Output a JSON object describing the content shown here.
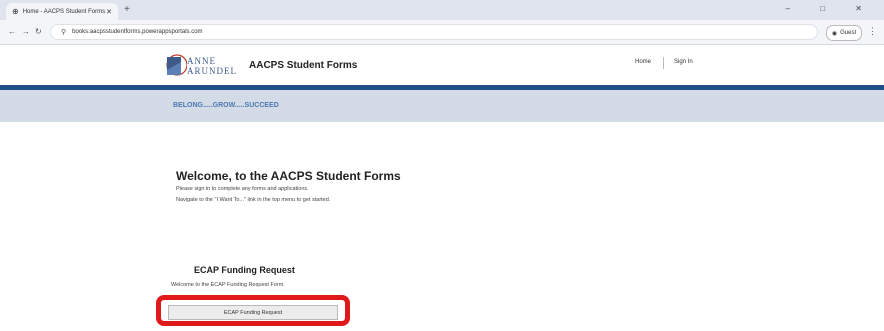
{
  "browser": {
    "tab_title": "Home - AACPS Student Forms",
    "new_tab": "+",
    "window_controls": "–  □  ✕",
    "url": "books.aacpsstudentforms.powerappsportals.com",
    "profile_label": "Guest"
  },
  "header": {
    "logo_line1": "ANNE",
    "logo_line2": "ARUNDEL",
    "site_title": "AACPS Student Forms",
    "nav": {
      "home": "Home",
      "sign_in": "Sign In"
    },
    "colors": {
      "blue_bar": "#1f4e86",
      "slogan_bg": "#d3dbe6",
      "slogan_text": "#4c78b2"
    }
  },
  "banner": {
    "slogan": "BELONG.....GROW.....SUCCEED"
  },
  "main": {
    "welcome_title": "Welcome, to the AACPS Student Forms",
    "intro_line1": "Please sign in to complete any forms and applications.",
    "intro_line2": "Navigate to the \"I Want To...\" link in the top menu to get started."
  },
  "ecap": {
    "title": "ECAP Funding Request",
    "subtitle": "Welcome to the ECAP Funding Request Form.",
    "button_label": "ECAP Funding Request",
    "highlight_color": "#e0191b"
  }
}
